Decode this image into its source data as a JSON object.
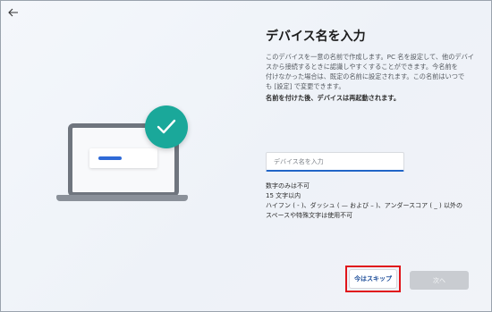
{
  "header": {
    "back_icon": "arrow-left-icon"
  },
  "illustration": {
    "badge_icon": "checkmark-icon",
    "badge_color": "#1aa89a",
    "accent_color": "#2f6ad7"
  },
  "main": {
    "title": "デバイス名を入力",
    "description_lines": [
      "このデバイスを一意の名前で作成します。PC 名を設定して、他のデバイ",
      "スから接続するときに認識しやすくすることができます。今名前を",
      "付けなかった場合は、既定の名前に設定されます。この名前はいつで",
      "も [設定] で変更できます。"
    ],
    "restart_note": "名前を付けた後、デバイスは再起動されます。",
    "name_input": {
      "value": "",
      "placeholder": "デバイス名を入力"
    },
    "rules": [
      "数字のみは不可",
      "15 文字以内",
      "ハイフン ( - )、ダッシュ ( — および – )、アンダースコア ( _ ) 以外の",
      "スペースや特殊文字は使用不可"
    ]
  },
  "footer": {
    "skip_label": "今はスキップ",
    "next_label": "次へ",
    "highlight_color": "#e0151b"
  }
}
